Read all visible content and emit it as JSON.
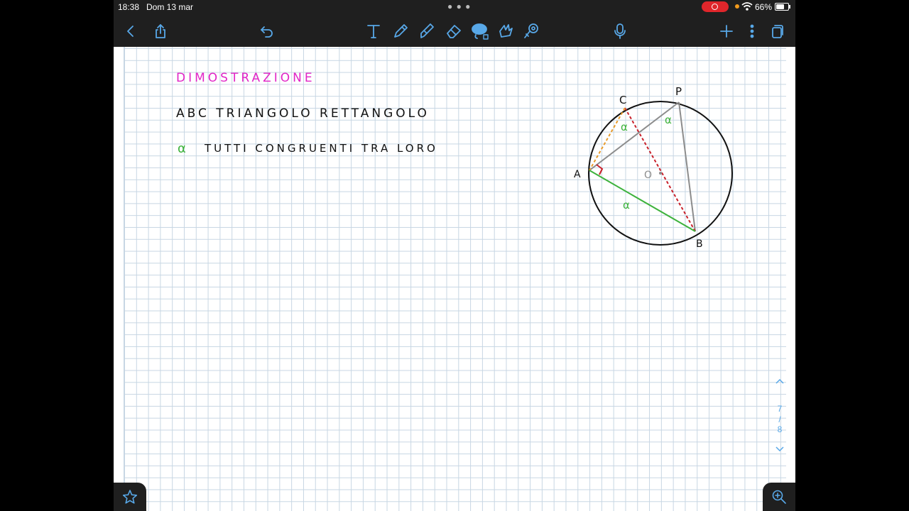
{
  "status_bar": {
    "time": "18:38",
    "date": "Dom 13 mar",
    "battery": "66%"
  },
  "toolbar": {
    "left": [
      "back-icon",
      "share-icon",
      "undo-icon"
    ],
    "tools": [
      "text-tool-icon",
      "pen-tool-icon",
      "highlighter-icon",
      "eraser-icon",
      "lasso-icon",
      "shapes-icon",
      "laser-pointer-icon"
    ],
    "right": [
      "microphone-icon",
      "add-page-icon",
      "more-options-icon",
      "pages-icon"
    ],
    "accent_color": "#58a8e8"
  },
  "note": {
    "title": "DIMOSTRAZIONE",
    "line1": "ABC TRIANGOLO RETTANGOLO",
    "line2_symbol": "α",
    "line2_text": "TUTTI CONGRUENTI TRA LORO",
    "title_color": "#e225c7",
    "alpha_color": "#3db23c"
  },
  "figure": {
    "labels": {
      "C": "C",
      "P": "P",
      "A": "A",
      "B": "B",
      "O": "O"
    },
    "angle_labels": [
      "α",
      "α",
      "α"
    ],
    "colors": {
      "circle": "#111111",
      "gray": "#8c8c8c",
      "red": "#c8202a",
      "orange": "#e89b2a",
      "green": "#3db23c"
    }
  },
  "pager": {
    "current": "7",
    "separator": "/",
    "total": "8"
  },
  "bottom": {
    "left": "star-icon",
    "right": "zoom-icon"
  }
}
